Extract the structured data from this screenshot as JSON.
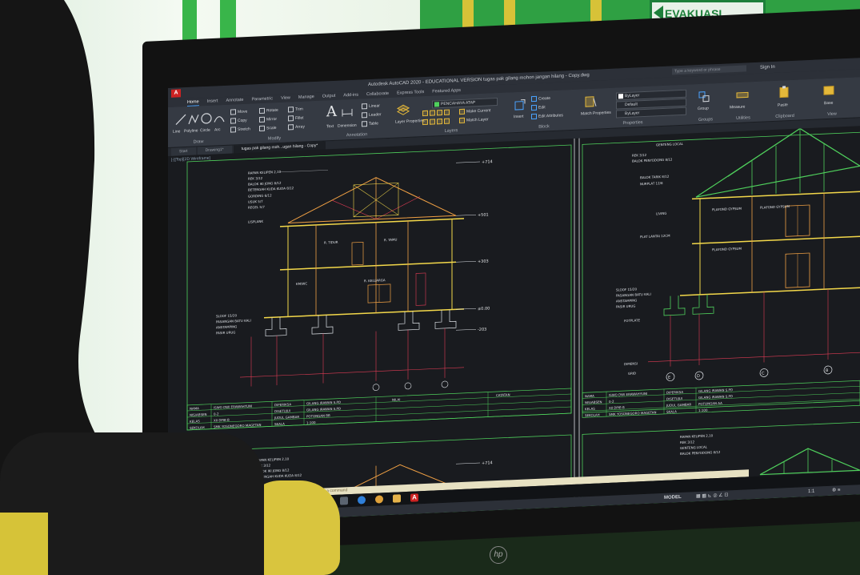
{
  "room": {
    "evac_sign": "EVAKUASI"
  },
  "autocad": {
    "title": "Autodesk AutoCAD 2020 - EDUCATIONAL VERSION   tugas pak gilang mohon jangan hilang - Copy.dwg",
    "search_placeholder": "Type a keyword or phrase",
    "sign_in": "Sign In",
    "tabs": [
      "Home",
      "Insert",
      "Annotate",
      "Parametric",
      "View",
      "Manage",
      "Output",
      "Add-ins",
      "Collaborate",
      "Express Tools",
      "Featured Apps"
    ],
    "active_tab": "Home",
    "ribbon": {
      "draw": {
        "label": "Draw",
        "line": "Line",
        "polyline": "Polyline",
        "circle": "Circle",
        "arc": "Arc"
      },
      "modify": {
        "label": "Modify",
        "move": "Move",
        "rotate": "Rotate",
        "trim": "Trim",
        "copy": "Copy",
        "mirror": "Mirror",
        "fillet": "Fillet",
        "stretch": "Stretch",
        "scale": "Scale",
        "array": "Array"
      },
      "annotation": {
        "label": "Annotation",
        "text": "Text",
        "dimension": "Dimension",
        "linear": "Linear",
        "leader": "Leader",
        "table": "Table"
      },
      "layers": {
        "label": "Layers",
        "layer_properties": "Layer Properties",
        "current_layer": "PENCAHAYA ATAP",
        "make_current": "Make Current",
        "match_layer": "Match Layer"
      },
      "block": {
        "label": "Block",
        "insert": "Insert",
        "create": "Create",
        "edit": "Edit",
        "edit_attributes": "Edit Attributes"
      },
      "properties": {
        "label": "Properties",
        "match_properties": "Match Properties",
        "color": "ByLayer",
        "linetype": "Default",
        "lineweight": "ByLayer"
      },
      "groups": {
        "label": "Groups",
        "group": "Group"
      },
      "utilities": {
        "label": "Utilities",
        "measure": "Measure"
      },
      "clipboard": {
        "label": "Clipboard",
        "paste": "Paste"
      },
      "view": {
        "label": "View",
        "base": "Base"
      }
    },
    "doc_tabs": [
      "Start",
      "Drawing1*",
      "tugas pak gilang moh...ugan hilang - Copy*"
    ],
    "viewport_label": "[-][Top][2D Wireframe]",
    "command_placeholder": "Type a command",
    "status": {
      "model": "MODEL",
      "scale": "1:1"
    }
  },
  "drawing": {
    "left_section": {
      "levels": [
        "+714",
        "+501",
        "+303",
        "±0.00",
        "-203"
      ],
      "labels": [
        "RAPAN KELIPEN 2,10",
        "REK 3/12",
        "BALOK IKI JONG 8/12",
        "BETENGAH KUDA KUDA 8/12",
        "GORDING 6/12",
        "USUK 5/7",
        "REGEL 5/7",
        "LISPLANK",
        "SLOOF 15/20",
        "PASANGAN BATU KALI",
        "ANSTAMPING",
        "PASIR URUG"
      ],
      "room_labels": [
        "R. TIDUR",
        "R. TAMU",
        "KM/WC",
        "R. KELUARGA"
      ],
      "title_block": [
        [
          "NAMA",
          "ISWO DWI ERAWAHYUNI",
          "DIPERIKSA",
          "GILANG IRAWAN S.PD",
          "NILAI",
          "CATATAN"
        ],
        [
          "NIS/ABSEN",
          "0-2",
          "DISETUJUI",
          "GILANG IRAWAN S.PD"
        ],
        [
          "KELAS",
          "XII DPIB B",
          "JUDUL GAMBAR",
          "POTONGAN BB"
        ],
        [
          "SEKOLAH",
          "SMK YOSONEGORO MAGETAN",
          "SKALA",
          "1:100"
        ]
      ]
    },
    "right_section": {
      "labels": [
        "GENTENG LOCAL",
        "REK 3/12",
        "BALOK PENYODONG 8/12",
        "BALOK TARIK 8/12",
        "NURPLAT 12/8",
        "LIVING",
        "PLAT LANTAI 12CM",
        "SLOOF 15/20",
        "PASANGAN BATU KALI",
        "ANSTAMPING",
        "PASIR URUG",
        "FOTPLATE",
        "DIMENSI",
        "GRID"
      ],
      "room_labels": [
        "PLAFOND GYPSUM",
        "PLAFOND GYPSUM",
        "PLAFOND GYPSUM"
      ],
      "grid_bubbles": [
        "E",
        "D",
        "C",
        "B"
      ],
      "title_block": [
        [
          "NAMA",
          "ISWO DWI ERAWAHYUNI",
          "DIPERIKSA",
          "GILANG IRAWAN S.PD"
        ],
        [
          "NIS/ABSEN",
          "0-2",
          "DISETUJUI",
          "GILANG IRAWAN S.PD"
        ],
        [
          "KELAS",
          "XII DPIB B",
          "JUDUL GAMBAR",
          "POTONGAN AA"
        ],
        [
          "SEKOLAH",
          "SMK YOSONEGORO MAGETAN",
          "SKALA",
          "1:100"
        ]
      ]
    },
    "bottom_left": {
      "level": "+714",
      "labels": [
        "RAPAN KELIPEN 2,10",
        "REK 3/12",
        "BALOK IKI JONG 8/12",
        "BETENGAH KUDA KUDA 8/12"
      ]
    },
    "bottom_right": {
      "labels": [
        "RAPAN KELIPEN 2,10",
        "REK 3/12",
        "GENTENG LOCAL",
        "BALOK PENYODONG 8/12"
      ]
    }
  },
  "monitor": {
    "brand": "hp"
  },
  "colors": {
    "cad_green": "#4fd05c",
    "cad_orange": "#f0a044",
    "cad_red": "#e03c55",
    "cad_yellow": "#f3d84a",
    "cad_bg": "#191b1f"
  }
}
